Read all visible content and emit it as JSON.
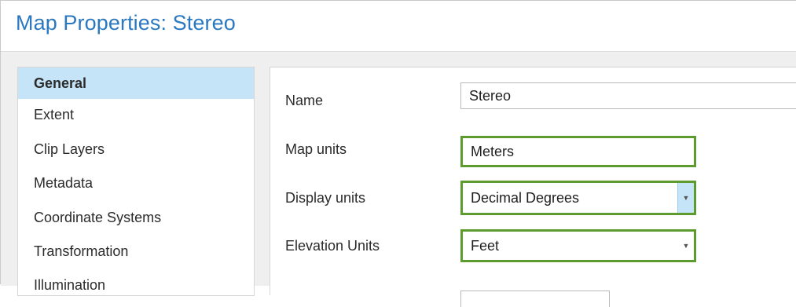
{
  "window": {
    "title": "Map Properties: Stereo"
  },
  "sidebar": {
    "items": [
      {
        "label": "General",
        "active": true
      },
      {
        "label": "Extent",
        "active": false
      },
      {
        "label": "Clip Layers",
        "active": false
      },
      {
        "label": "Metadata",
        "active": false
      },
      {
        "label": "Coordinate Systems",
        "active": false
      },
      {
        "label": "Transformation",
        "active": false
      },
      {
        "label": "Illumination",
        "active": false
      }
    ]
  },
  "form": {
    "name": {
      "label": "Name",
      "value": "Stereo"
    },
    "map_units": {
      "label": "Map units",
      "value": "Meters"
    },
    "display_units": {
      "label": "Display units",
      "value": "Decimal Degrees"
    },
    "elevation_units": {
      "label": "Elevation Units",
      "value": "Feet"
    }
  },
  "colors": {
    "title": "#2a78c0",
    "highlight_border": "#5d9b2f",
    "selected_bg": "#c5e4f7"
  }
}
